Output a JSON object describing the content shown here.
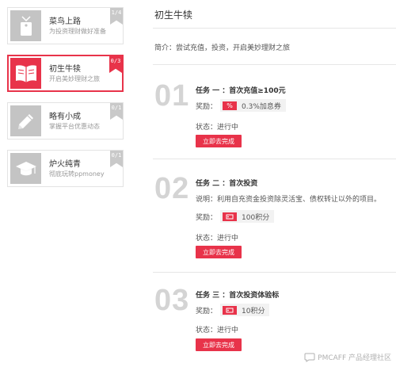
{
  "sidebar": {
    "items": [
      {
        "title": "菜鸟上路",
        "subtitle": "为投资理财做好准备",
        "progress": "1/4",
        "icon": "tag-icon"
      },
      {
        "title": "初生牛犊",
        "subtitle": "开启美妙理财之旅",
        "progress": "0/3",
        "icon": "book-icon"
      },
      {
        "title": "略有小成",
        "subtitle": "掌握平台优惠动态",
        "progress": "0/1",
        "icon": "pen-icon"
      },
      {
        "title": "炉火纯青",
        "subtitle": "彻底玩转ppmoney",
        "progress": "0/1",
        "icon": "graduation-cap-icon"
      }
    ]
  },
  "main": {
    "title": "初生牛犊",
    "intro": "简介：尝试充值，投资，开启美妙理财之旅",
    "tasks": [
      {
        "number": "01",
        "title": "任务 一 ：首次充值≥100元",
        "reward_label": "奖励：",
        "reward_tag": "%",
        "reward_value": "0.3%加息券",
        "status": "状态：进行中",
        "button": "立即去完成"
      },
      {
        "number": "02",
        "title": "任务 二 ：首次投资",
        "description": "说明：利用自充资金投资除灵活宝、债权转让以外的项目。",
        "reward_label": "奖励：",
        "reward_value": "100积分",
        "status": "状态：进行中",
        "button": "立即去完成"
      },
      {
        "number": "03",
        "title": "任务 三 ：首次投资体验标",
        "reward_label": "奖励：",
        "reward_value": "10积分",
        "status": "状态：进行中",
        "button": "立即去完成"
      }
    ]
  },
  "watermark": "PMCAFF 产品经理社区",
  "colors": {
    "accent": "#e8334a",
    "inactive": "#c4c4c4",
    "number": "#d4d4d4"
  }
}
